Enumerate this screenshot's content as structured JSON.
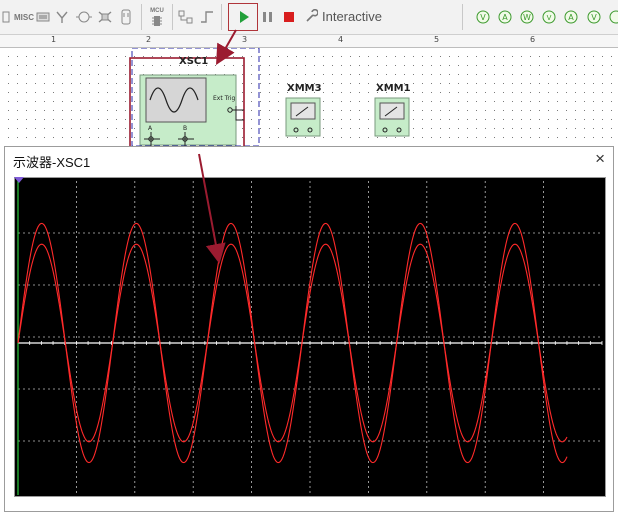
{
  "toolbar": {
    "misc_label": "MISC",
    "mcu_label": "MCU",
    "mode_label": "Interactive"
  },
  "ruler": {
    "ticks": [
      "1",
      "2",
      "3",
      "4",
      "5",
      "6"
    ]
  },
  "schematic": {
    "oscilloscope": {
      "ref": "XSC1",
      "ext_trig": "Ext Trig",
      "channel_a": "A",
      "channel_b": "B"
    },
    "multimeters": [
      {
        "ref": "XMM3"
      },
      {
        "ref": "XMM1"
      }
    ]
  },
  "scope_window": {
    "title": "示波器-XSC1",
    "close_glyph": "×",
    "grid": {
      "columns": 10,
      "rows": 6
    },
    "traces": [
      {
        "channel": "A",
        "amplitude_divs": 2.3,
        "color": "#ff2a2a"
      },
      {
        "channel": "B",
        "amplitude_divs": 1.9,
        "color": "#ff2a2a"
      }
    ],
    "cycles_shown": 5.8
  },
  "colors": {
    "accent": "#9b1b30",
    "screen_bg": "#000000",
    "trace": "#ff2a2a",
    "window_icon": "#7f5bd8"
  }
}
